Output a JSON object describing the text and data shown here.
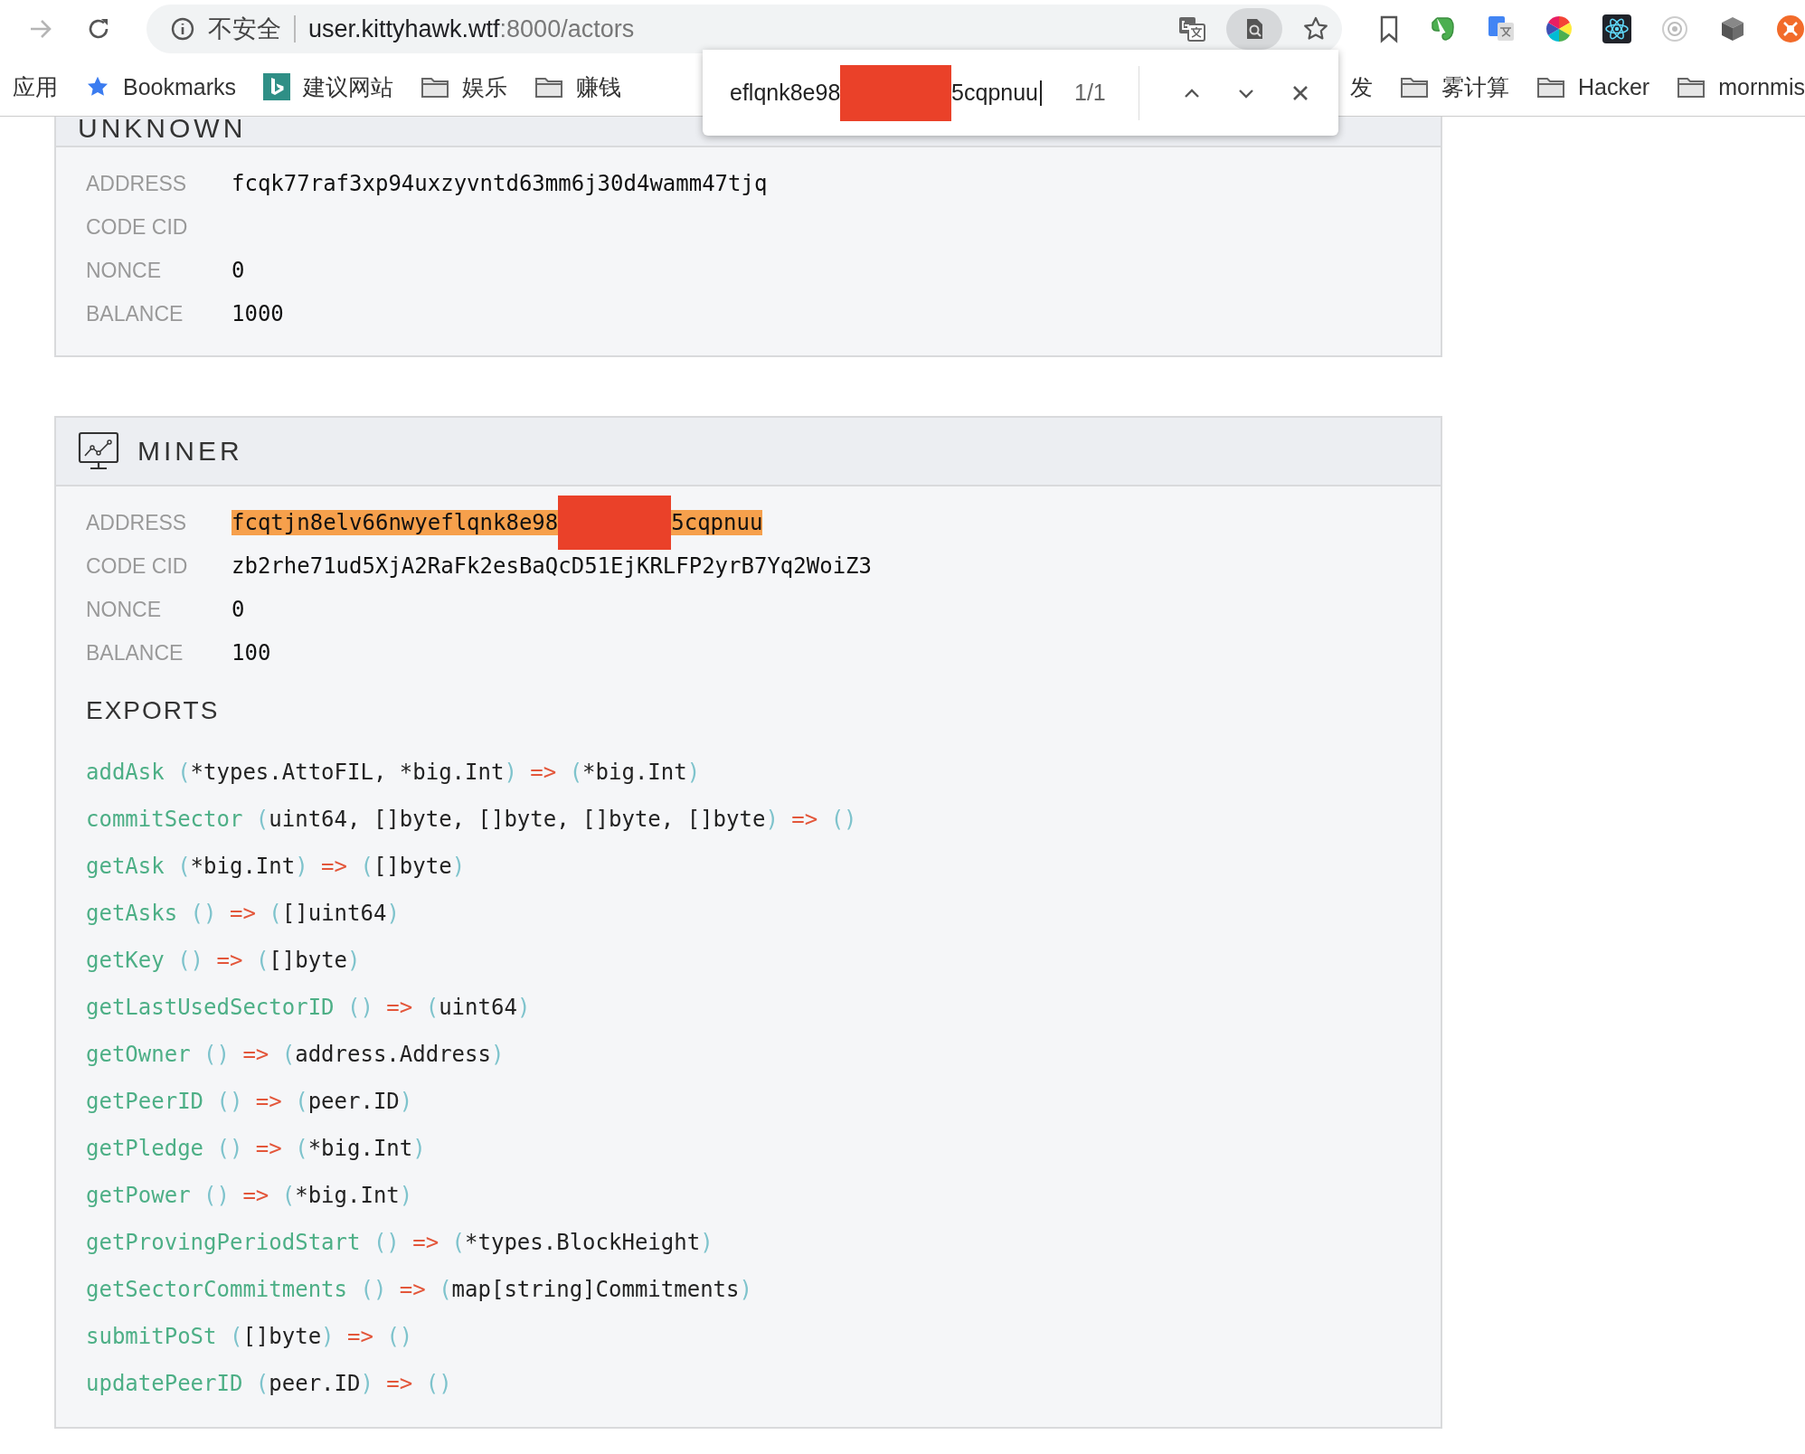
{
  "browser": {
    "forward_disabled": true,
    "security": "不安全",
    "url_host": "user.kittyhawk.wtf",
    "url_path": ":8000/actors"
  },
  "bookmarks": [
    {
      "kind": "text",
      "label": "应用"
    },
    {
      "kind": "star",
      "label": "Bookmarks"
    },
    {
      "kind": "bing",
      "label": "建议网站"
    },
    {
      "kind": "folder",
      "label": "娱乐"
    },
    {
      "kind": "folder",
      "label": "赚钱"
    }
  ],
  "bookmarks_right": [
    {
      "kind": "text",
      "label": "发"
    },
    {
      "kind": "folder",
      "label": "雾计算"
    },
    {
      "kind": "folder",
      "label": "Hacker"
    },
    {
      "kind": "folder",
      "label": "mornmis"
    }
  ],
  "find_bar": {
    "value_before": "eflqnk8e98",
    "value_after": "5cqpnuu",
    "count": "1/1"
  },
  "actors": [
    {
      "title": "UNKNOWN",
      "kind": "unknown",
      "fields": [
        {
          "label": "ADDRESS",
          "value": "fcqk77raf3xp94uxzyvntd63mm6j30d4wamm47tjq",
          "highlighted": false
        },
        {
          "label": "CODE CID"
        },
        {
          "label": "NONCE",
          "value": "0",
          "highlighted": false
        },
        {
          "label": "BALANCE",
          "value": "1000",
          "highlighted": false
        }
      ]
    },
    {
      "title": "MINER",
      "kind": "miner",
      "fields": [
        {
          "label": "ADDRESS",
          "value": "fcqtjn8elv66nwyeflqnk8e98",
          "value_after": "5cqpnuu",
          "highlighted": true
        },
        {
          "label": "CODE CID",
          "value": "zb2rhe71ud5XjA2RaFk2esBaQcD51EjKRLFP2yrB7Yq2WoiZ3",
          "highlighted": false
        },
        {
          "label": "NONCE",
          "value": "0",
          "highlighted": false
        },
        {
          "label": "BALANCE",
          "value": "100",
          "highlighted": false
        }
      ],
      "exports_title": "EXPORTS",
      "exports": [
        {
          "name": "addAsk",
          "params": "(*types.AttoFIL, *big.Int)",
          "arrow": "=>",
          "returns": "(*big.Int)"
        },
        {
          "name": "commitSector",
          "params": "(uint64, []byte, []byte, []byte, []byte)",
          "arrow": "=>",
          "returns": "()"
        },
        {
          "name": "getAsk",
          "params": "(*big.Int)",
          "arrow": "=>",
          "returns": "([]byte)"
        },
        {
          "name": "getAsks",
          "params": "()",
          "arrow": "=>",
          "returns": "([]uint64)"
        },
        {
          "name": "getKey",
          "params": "()",
          "arrow": "=>",
          "returns": "([]byte)"
        },
        {
          "name": "getLastUsedSectorID",
          "params": "()",
          "arrow": "=>",
          "returns": "(uint64)"
        },
        {
          "name": "getOwner",
          "params": "()",
          "arrow": "=>",
          "returns": "(address.Address)"
        },
        {
          "name": "getPeerID",
          "params": "()",
          "arrow": "=>",
          "returns": "(peer.ID)"
        },
        {
          "name": "getPledge",
          "params": "()",
          "arrow": "=>",
          "returns": "(*big.Int)"
        },
        {
          "name": "getPower",
          "params": "()",
          "arrow": "=>",
          "returns": "(*big.Int)"
        },
        {
          "name": "getProvingPeriodStart",
          "params": "()",
          "arrow": "=>",
          "returns": "(*types.BlockHeight)"
        },
        {
          "name": "getSectorCommitments",
          "params": "()",
          "arrow": "=>",
          "returns": "(map[string]Commitments)"
        },
        {
          "name": "submitPoSt",
          "params": "([]byte)",
          "arrow": "=>",
          "returns": "()"
        },
        {
          "name": "updatePeerID",
          "params": "(peer.ID)",
          "arrow": "=>",
          "returns": "()"
        }
      ]
    }
  ]
}
